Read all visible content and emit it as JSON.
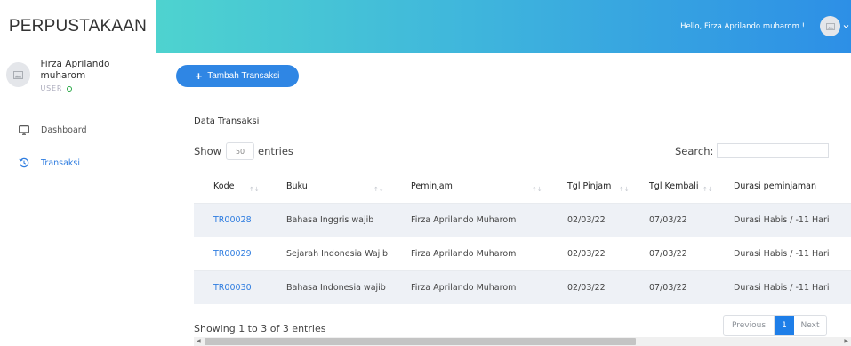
{
  "brand": "PERPUSTAKAAN",
  "user": {
    "name": "Firza Aprilando muharom",
    "role": "USER"
  },
  "nav": {
    "items": [
      {
        "label": "Dashboard",
        "icon": "monitor-icon"
      },
      {
        "label": "Transaksi",
        "icon": "history-icon"
      }
    ]
  },
  "header": {
    "greeting": "Hello, Firza Aprilando muharom !"
  },
  "actions": {
    "add_label": "Tambah Transaksi"
  },
  "card": {
    "title": "Data Transaksi"
  },
  "length": {
    "show_label": "Show",
    "value": "50",
    "entries_label": "entries"
  },
  "search": {
    "label": "Search:",
    "value": ""
  },
  "table": {
    "headers": [
      "Kode",
      "Buku",
      "Peminjam",
      "Tgl Pinjam",
      "Tgl Kembali",
      "Durasi peminjaman"
    ],
    "rows": [
      [
        "TR00028",
        "Bahasa Inggris wajib",
        "Firza Aprilando Muharom",
        "02/03/22",
        "07/03/22",
        "Durasi Habis / -11 Hari"
      ],
      [
        "TR00029",
        "Sejarah Indonesia Wajib",
        "Firza Aprilando Muharom",
        "02/03/22",
        "07/03/22",
        "Durasi Habis / -11 Hari"
      ],
      [
        "TR00030",
        "Bahasa Indonesia wajib",
        "Firza Aprilando Muharom",
        "02/03/22",
        "07/03/22",
        "Durasi Habis / -11 Hari"
      ]
    ]
  },
  "info": "Showing 1 to 3 of 3 entries",
  "pagination": {
    "previous": "Previous",
    "current": "1",
    "next": "Next"
  },
  "colors": {
    "accent": "#2f86e4",
    "topbar_start": "#4ed3cf",
    "topbar_end": "#2d8fe6",
    "online": "#28a745",
    "link": "#2f7de0"
  }
}
